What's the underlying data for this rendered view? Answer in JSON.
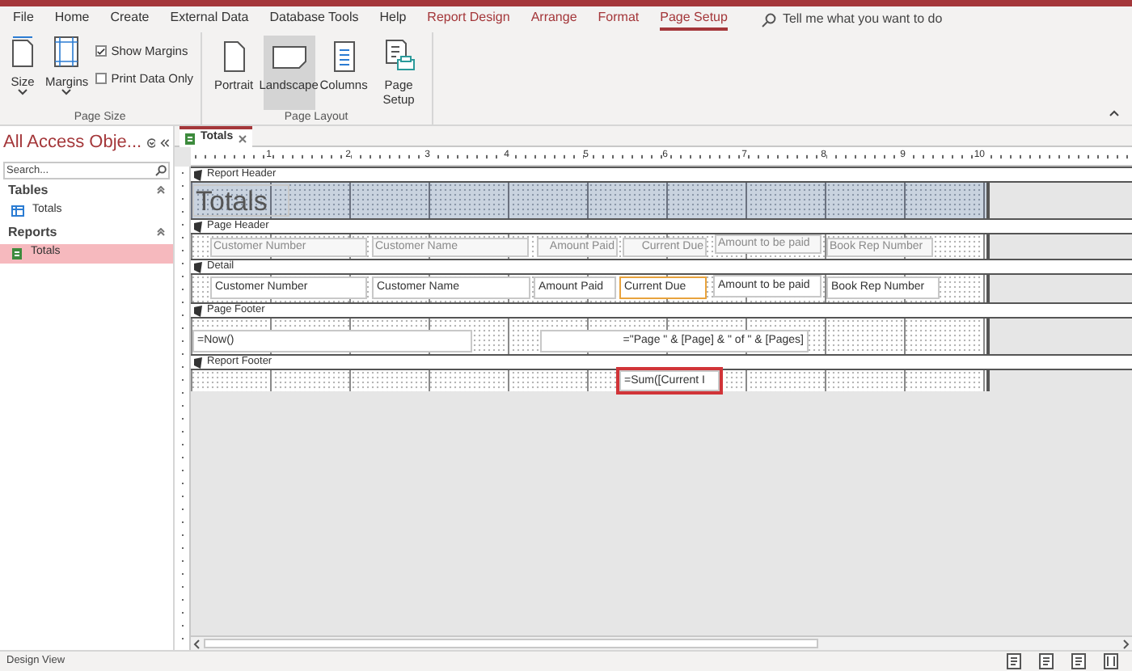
{
  "menu_tabs": [
    {
      "label": "File",
      "contextual": false,
      "selected": false
    },
    {
      "label": "Home",
      "contextual": false,
      "selected": false
    },
    {
      "label": "Create",
      "contextual": false,
      "selected": false
    },
    {
      "label": "External Data",
      "contextual": false,
      "selected": false
    },
    {
      "label": "Database Tools",
      "contextual": false,
      "selected": false
    },
    {
      "label": "Help",
      "contextual": false,
      "selected": false
    },
    {
      "label": "Report Design",
      "contextual": true,
      "selected": false
    },
    {
      "label": "Arrange",
      "contextual": true,
      "selected": false
    },
    {
      "label": "Format",
      "contextual": true,
      "selected": false
    },
    {
      "label": "Page Setup",
      "contextual": true,
      "selected": true
    }
  ],
  "tell_me": {
    "placeholder": "Tell me what you want to do"
  },
  "ribbon": {
    "groups": [
      {
        "title": "Page Size",
        "items": [
          {
            "kind": "dropdown",
            "label": "Size"
          },
          {
            "kind": "dropdown",
            "label": "Margins"
          },
          {
            "kind": "checkbox",
            "label": "Show Margins",
            "checked": true
          },
          {
            "kind": "checkbox",
            "label": "Print Data Only",
            "checked": false
          }
        ]
      },
      {
        "title": "Page Layout",
        "items": [
          {
            "kind": "button",
            "label": "Portrait",
            "selected": false
          },
          {
            "kind": "button",
            "label": "Landscape",
            "selected": true
          },
          {
            "kind": "button",
            "label": "Columns",
            "selected": false
          },
          {
            "kind": "button",
            "label": "Page Setup",
            "selected": false
          }
        ]
      }
    ]
  },
  "nav_pane": {
    "title": "All Access Obje...",
    "search": {
      "placeholder": "Search..."
    },
    "groups": [
      {
        "title": "Tables",
        "items": [
          {
            "kind": "table",
            "label": "Totals",
            "selected": false
          }
        ]
      },
      {
        "title": "Reports",
        "items": [
          {
            "kind": "report",
            "label": "Totals",
            "selected": true
          }
        ]
      }
    ]
  },
  "document_tab": {
    "label": "Totals"
  },
  "ruler": [
    "1",
    "2",
    "3",
    "4",
    "5",
    "6",
    "7",
    "8",
    "9",
    "10"
  ],
  "sections": [
    {
      "title": "Report Header",
      "kind": "header",
      "controls": [
        {
          "kind": "title",
          "text": "Totals",
          "selected": false,
          "highlighted": false
        }
      ]
    },
    {
      "title": "Page Header",
      "kind": "plain",
      "controls": [
        {
          "kind": "label",
          "text": "Customer Number",
          "selected": false,
          "highlighted": false
        },
        {
          "kind": "label",
          "text": "Customer Name",
          "selected": false,
          "highlighted": false
        },
        {
          "kind": "label",
          "text": "Amount Paid",
          "selected": false,
          "highlighted": false
        },
        {
          "kind": "label",
          "text": "Current Due",
          "selected": false,
          "highlighted": false
        },
        {
          "kind": "label",
          "text": "Amount to be paid",
          "selected": false,
          "highlighted": false
        },
        {
          "kind": "label",
          "text": "Book Rep Number",
          "selected": false,
          "highlighted": false
        }
      ]
    },
    {
      "title": "Detail",
      "kind": "plain",
      "controls": [
        {
          "kind": "textbox",
          "text": "Customer Number",
          "selected": false,
          "highlighted": false
        },
        {
          "kind": "textbox",
          "text": "Customer Name",
          "selected": false,
          "highlighted": false
        },
        {
          "kind": "textbox",
          "text": "Amount Paid",
          "selected": false,
          "highlighted": false
        },
        {
          "kind": "textbox",
          "text": "Current Due",
          "selected": true,
          "highlighted": false
        },
        {
          "kind": "textbox",
          "text": "Amount to be paid",
          "selected": false,
          "highlighted": false
        },
        {
          "kind": "textbox",
          "text": "Book Rep Number",
          "selected": false,
          "highlighted": false
        }
      ]
    },
    {
      "title": "Page Footer",
      "kind": "plain",
      "controls": [
        {
          "kind": "textbox",
          "text": "=Now()",
          "selected": false,
          "highlighted": false
        },
        {
          "kind": "textbox_right",
          "text": "=\"Page \" & [Page] & \" of \" & [Pages]",
          "selected": false,
          "highlighted": false
        }
      ]
    },
    {
      "title": "Report Footer",
      "kind": "plain",
      "controls": [
        {
          "kind": "textbox",
          "text": "=Sum([Current I",
          "selected": false,
          "highlighted": true
        }
      ]
    }
  ],
  "status_bar": {
    "text": "Design View"
  }
}
